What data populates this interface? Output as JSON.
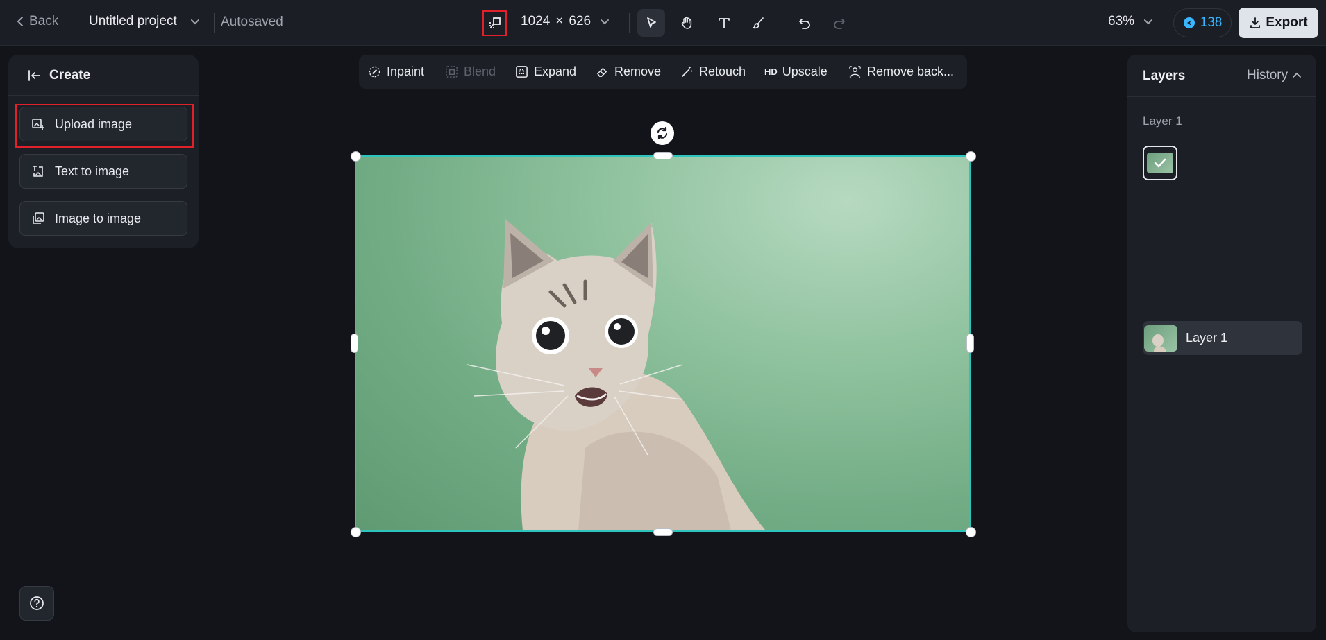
{
  "topbar": {
    "back_label": "Back",
    "project_name": "Untitled project",
    "save_status": "Autosaved",
    "canvas_width": "1024",
    "canvas_times": "×",
    "canvas_height": "626",
    "zoom": "63%",
    "credits": "138",
    "export_label": "Export"
  },
  "create_panel": {
    "title": "Create",
    "items": [
      {
        "label": "Upload image",
        "icon": "upload-image-icon"
      },
      {
        "label": "Text to image",
        "icon": "text-to-image-icon"
      },
      {
        "label": "Image to image",
        "icon": "image-to-image-icon"
      }
    ]
  },
  "edit_toolbar": {
    "items": [
      {
        "label": "Inpaint",
        "icon": "inpaint-icon",
        "enabled": true
      },
      {
        "label": "Blend",
        "icon": "blend-icon",
        "enabled": false
      },
      {
        "label": "Expand",
        "icon": "expand-icon",
        "enabled": true
      },
      {
        "label": "Remove",
        "icon": "eraser-icon",
        "enabled": true
      },
      {
        "label": "Retouch",
        "icon": "magic-wand-icon",
        "enabled": true
      },
      {
        "label": "Upscale",
        "icon": "hd-icon",
        "badge": "HD",
        "enabled": true
      },
      {
        "label": "Remove back...",
        "icon": "remove-background-icon",
        "enabled": true
      }
    ]
  },
  "right_panel": {
    "tab_layers": "Layers",
    "tab_history": "History",
    "history_section_label": "Layer 1",
    "layer_item_name": "Layer 1"
  },
  "colors": {
    "accent_teal": "#2ec4be",
    "highlight_red": "#e0202b",
    "credits_blue": "#39b6ff",
    "export_bg": "#dfe3ea"
  }
}
